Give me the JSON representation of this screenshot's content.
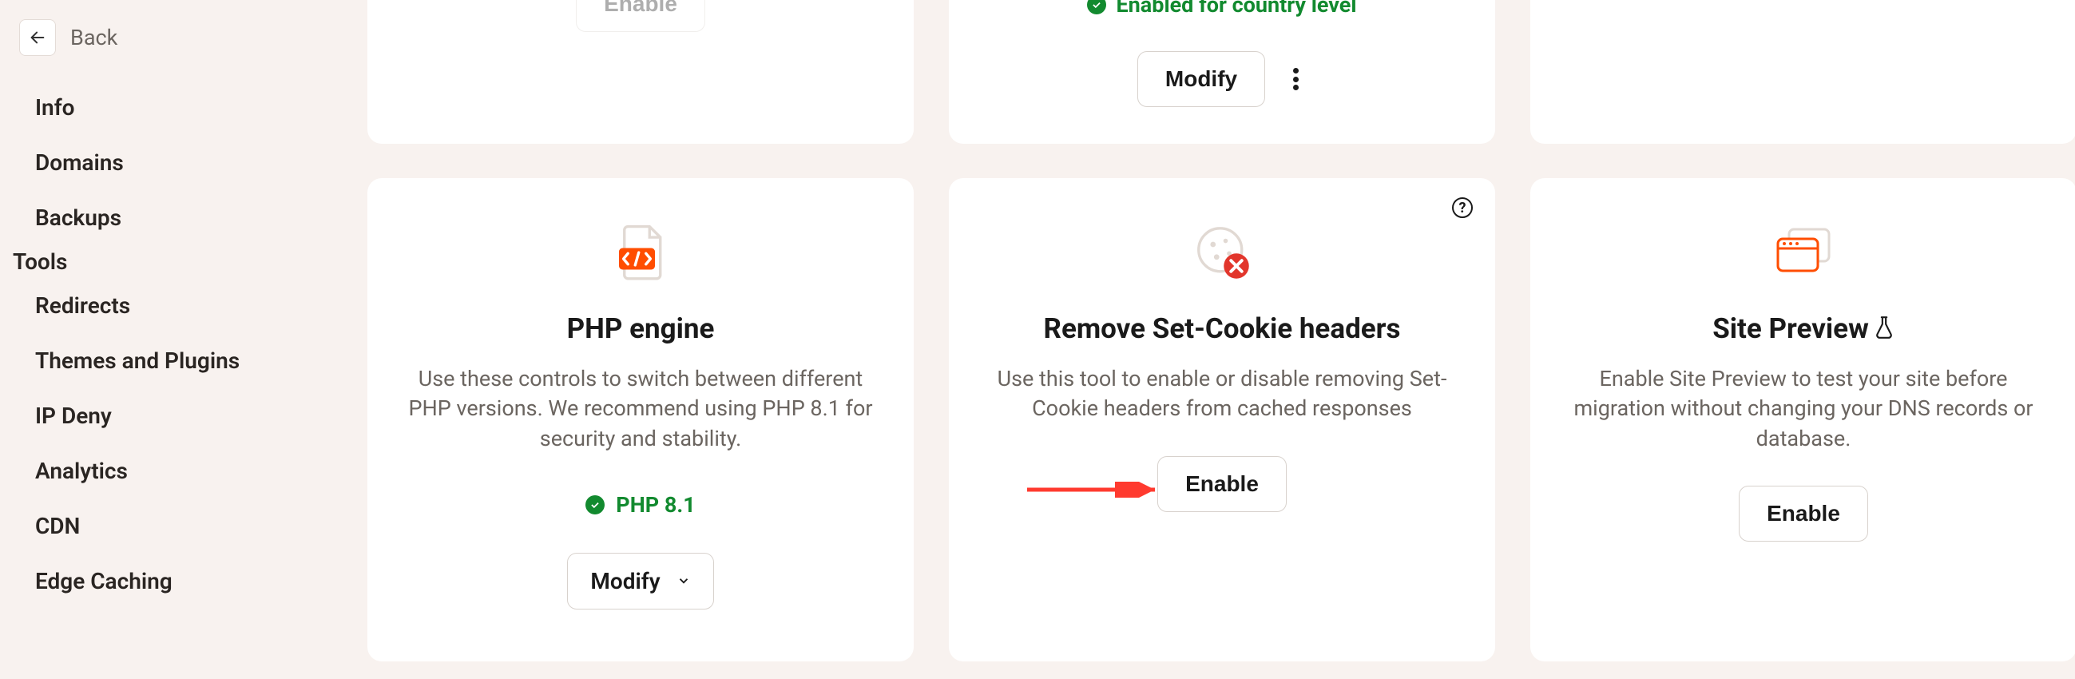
{
  "back": {
    "label": "Back"
  },
  "nav": {
    "items": [
      {
        "label": "Info"
      },
      {
        "label": "Domains"
      },
      {
        "label": "Backups"
      },
      {
        "label": "Tools"
      },
      {
        "label": "Redirects"
      },
      {
        "label": "Themes and Plugins"
      },
      {
        "label": "IP Deny"
      },
      {
        "label": "Analytics"
      },
      {
        "label": "CDN"
      },
      {
        "label": "Edge Caching"
      }
    ],
    "active_index": 3
  },
  "top_cards": {
    "card2": {
      "status_text": "Enabled for country level",
      "modify_label": "Modify"
    }
  },
  "cards": {
    "php": {
      "title": "PHP engine",
      "desc": "Use these controls to switch between different PHP versions. We recommend using PHP 8.1 for security and stability.",
      "status_text": "PHP 8.1",
      "modify_label": "Modify"
    },
    "cookie": {
      "title": "Remove Set-Cookie headers",
      "desc": "Use this tool to enable or disable removing Set-Cookie headers from cached responses",
      "button_label": "Enable"
    },
    "preview": {
      "title": "Site Preview",
      "flask": "⚗",
      "desc": "Enable Site Preview to test your site before migration without changing your DNS records or database.",
      "button_label": "Enable"
    }
  },
  "colors": {
    "accent": "#ff4d00",
    "success": "#128a2f"
  }
}
